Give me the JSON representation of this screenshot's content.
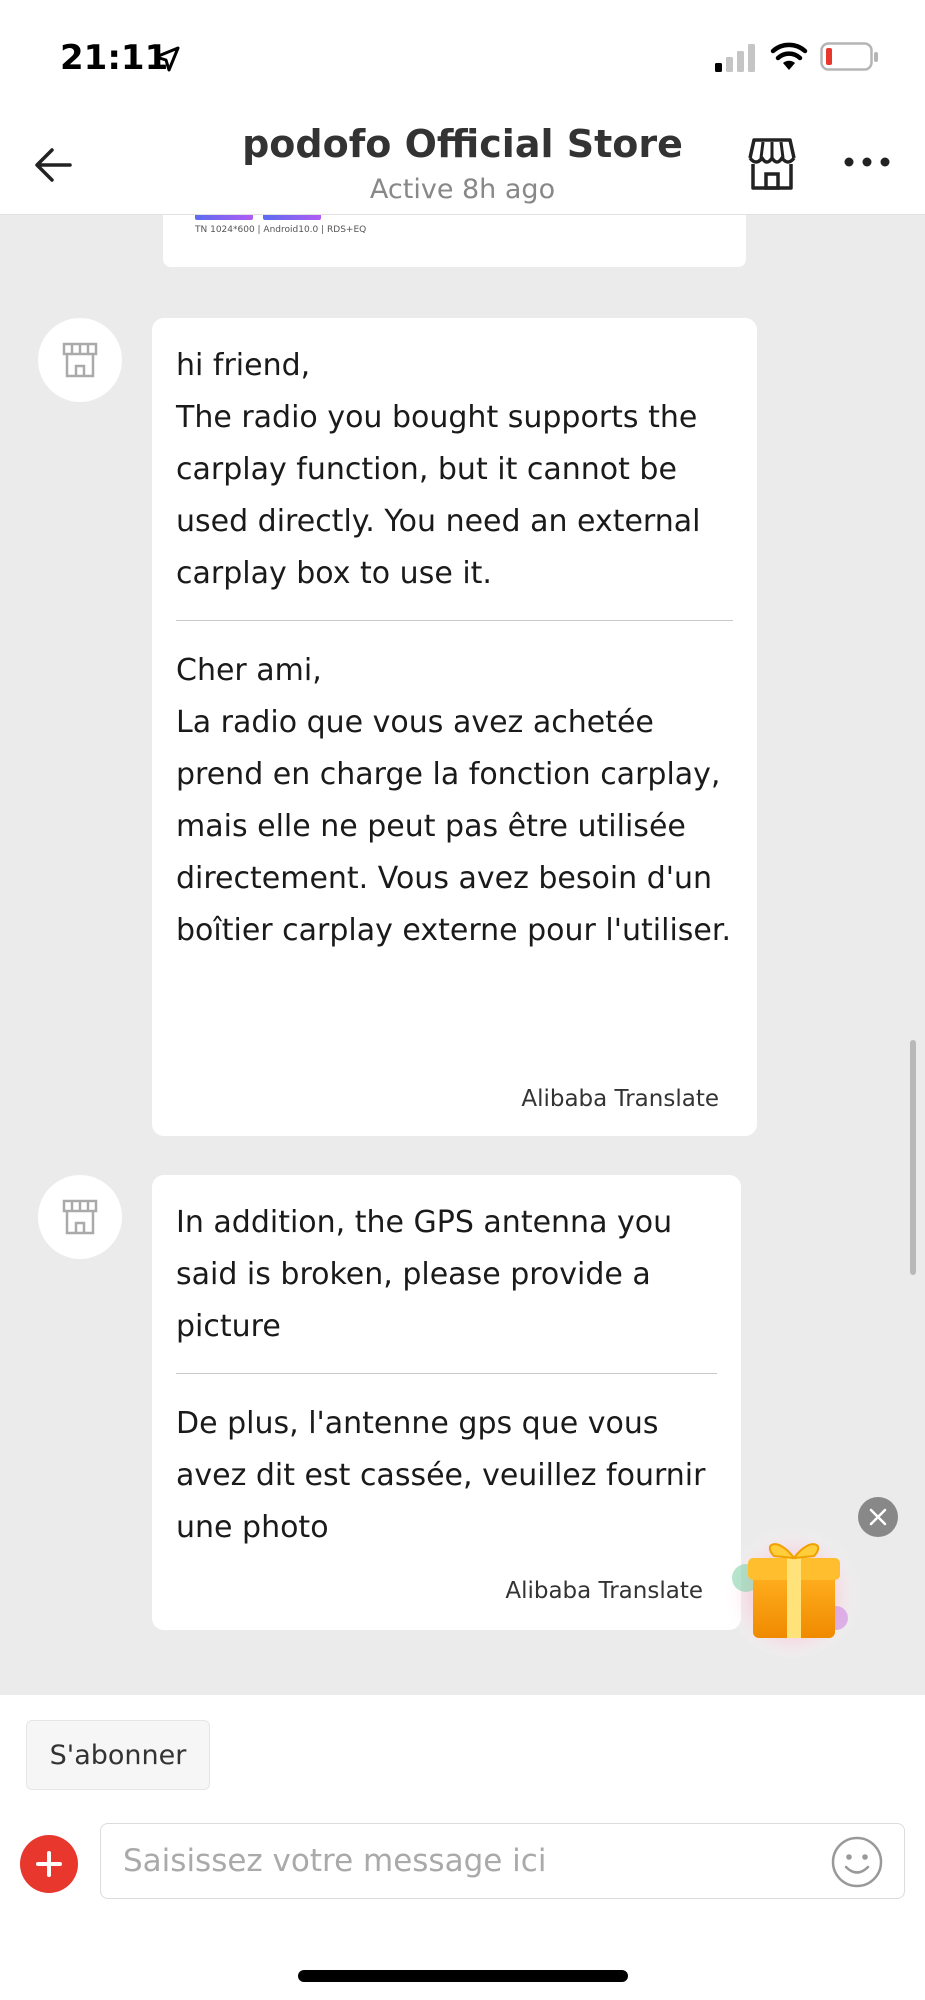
{
  "status_bar": {
    "time": "21:11"
  },
  "header": {
    "title": "podofo Official Store",
    "subtitle": "Active 8h ago"
  },
  "previous_card": {
    "meta": "TN 1024*600  |  Android10.0  |  RDS+EQ"
  },
  "messages": [
    {
      "original": "hi friend,\nThe radio you bought supports the carplay function, but it cannot be used directly. You need an external carplay box to use it.",
      "translation": "Cher ami,\nLa radio que vous avez achetée prend en charge la fonction carplay, mais elle ne peut pas être utilisée directement. Vous avez besoin d'un boîtier carplay externe pour l'utiliser.",
      "translator": "Alibaba Translate"
    },
    {
      "original": "In addition, the GPS antenna you said is broken, please provide a picture",
      "translation": "De plus, l'antenne gps que vous avez dit est cassée, veuillez fournir une photo",
      "translator": "Alibaba Translate"
    }
  ],
  "bottom": {
    "subscribe_label": "S'abonner",
    "input_placeholder": "Saisissez votre message ici"
  },
  "colors": {
    "accent_red": "#e8372c",
    "chat_background": "#ebebeb",
    "bubble": "#ffffff"
  },
  "icons": [
    "back-arrow-icon",
    "store-icon",
    "more-icon",
    "plus-icon",
    "emoji-icon",
    "gift-icon",
    "close-icon",
    "location-arrow-icon",
    "signal-icon",
    "wifi-icon",
    "battery-icon"
  ]
}
